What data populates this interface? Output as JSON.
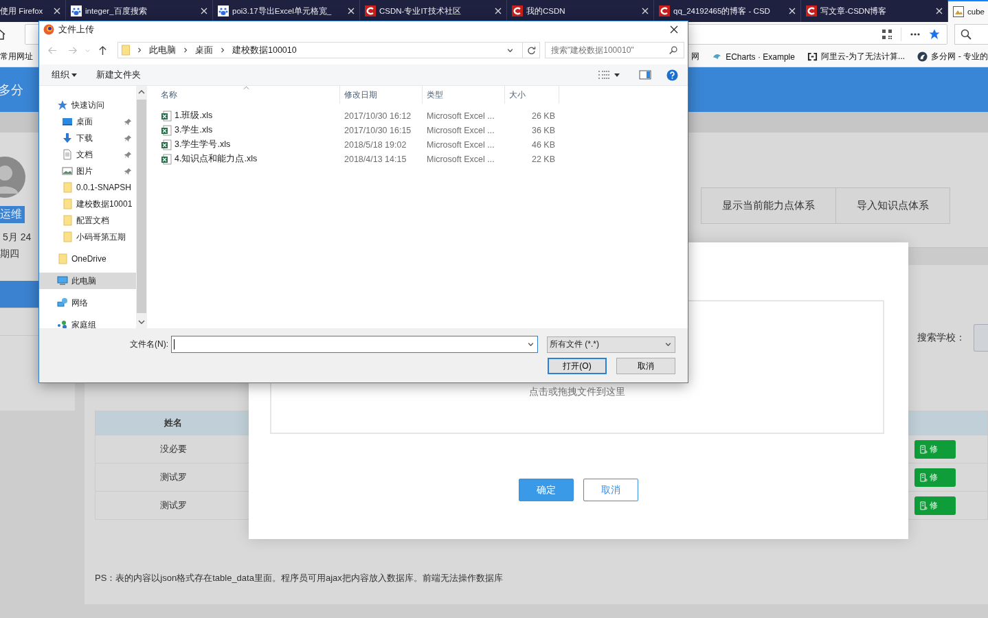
{
  "browser": {
    "tabs": [
      {
        "title": "使用 Firefox",
        "kind": "plain",
        "selected": false
      },
      {
        "title": "integer_百度搜索",
        "kind": "paw",
        "selected": false
      },
      {
        "title": "poi3.17导出Excel单元格宽_",
        "kind": "paw",
        "selected": false
      },
      {
        "title": "CSDN-专业IT技术社区",
        "kind": "csdn",
        "selected": false
      },
      {
        "title": "我的CSDN",
        "kind": "csdn",
        "selected": false
      },
      {
        "title": "qq_24192465的博客 - CSD",
        "kind": "csdn",
        "selected": false
      },
      {
        "title": "写文章-CSDN博客",
        "kind": "csdn",
        "selected": false
      },
      {
        "title": "cube",
        "kind": "image",
        "selected": true
      }
    ],
    "bookmarks": [
      {
        "label": "常用网址",
        "kind": "plain"
      },
      {
        "label": "网",
        "kind": "plain"
      },
      {
        "label": "ECharts · Example",
        "kind": "bird"
      },
      {
        "label": "阿里云-为了无法计算...",
        "kind": "bracket"
      },
      {
        "label": "多分网 - 专业的",
        "kind": "circle"
      }
    ]
  },
  "page": {
    "header_title": "多分",
    "user": {
      "name": "运维",
      "date": "5月 24",
      "weekday": "期四"
    },
    "menu": [
      {
        "selected": true
      },
      {
        "selected": false
      }
    ],
    "actions": [
      "显示当前能力点体系",
      "导入知识点体系"
    ],
    "search_label": "搜索学校：",
    "table": {
      "columns": [
        "姓名"
      ],
      "rows": [
        {
          "name": "没必要",
          "action": "修"
        },
        {
          "name": "测试罗",
          "action": "修"
        },
        {
          "name": "测试罗",
          "action": "修"
        }
      ]
    },
    "note": "PS：表的内容以json格式存在table_data里面。程序员可用ajax把内容放入数据库。前端无法操作数据库"
  },
  "upload_modal": {
    "drop_hint": "点击或拖拽文件到这里",
    "buttons": [
      {
        "label": "确定",
        "kind": "primary"
      },
      {
        "label": "取消",
        "kind": "default"
      }
    ]
  },
  "file_dialog": {
    "title": "文件上传",
    "path": [
      "此电脑",
      "桌面",
      "建校数据100010"
    ],
    "search": {
      "placeholder": "搜索\"建校数据100010\""
    },
    "toolbar": [
      {
        "label": "组织",
        "kind": "menu"
      },
      {
        "label": "新建文件夹",
        "kind": "plain"
      }
    ],
    "nav": [
      {
        "label": "快速访问",
        "kind": "star",
        "selected": false,
        "children": [
          {
            "label": "桌面",
            "kind": "desktop",
            "pinned": true,
            "selected": false
          },
          {
            "label": "下载",
            "kind": "download",
            "pinned": true,
            "selected": false
          },
          {
            "label": "文档",
            "kind": "document",
            "pinned": true,
            "selected": false
          },
          {
            "label": "图片",
            "kind": "image",
            "pinned": true,
            "selected": false
          },
          {
            "label": "0.0.1-SNAPSH",
            "kind": "folder",
            "pinned": false,
            "selected": false
          },
          {
            "label": "建校数据10001",
            "kind": "folder",
            "pinned": false,
            "selected": false
          },
          {
            "label": "配置文档",
            "kind": "folder",
            "pinned": false,
            "selected": false
          },
          {
            "label": "小码哥第五期",
            "kind": "folder",
            "pinned": false,
            "selected": false
          }
        ]
      },
      {
        "label": "OneDrive",
        "kind": "folder",
        "selected": false
      },
      {
        "label": "此电脑",
        "kind": "computer",
        "selected": true
      },
      {
        "label": "网络",
        "kind": "network",
        "selected": false
      },
      {
        "label": "家庭组",
        "kind": "group",
        "selected": false
      }
    ],
    "columns": [
      "名称",
      "修改日期",
      "类型",
      "大小"
    ],
    "files": [
      {
        "name": "1.班级.xls",
        "modified": "2017/10/30 16:12",
        "type": "Microsoft Excel ...",
        "size": "26 KB"
      },
      {
        "name": "3.学生.xls",
        "modified": "2017/10/30 16:15",
        "type": "Microsoft Excel ...",
        "size": "36 KB"
      },
      {
        "name": "3.学生学号.xls",
        "modified": "2018/5/18 19:02",
        "type": "Microsoft Excel ...",
        "size": "46 KB"
      },
      {
        "name": "4.知识点和能力点.xls",
        "modified": "2018/4/13 14:15",
        "type": "Microsoft Excel ...",
        "size": "22 KB"
      }
    ],
    "filename_label": "文件名(N):",
    "filter": "所有文件 (*.*)",
    "buttons": [
      {
        "label": "打开(O)",
        "kind": "default"
      },
      {
        "label": "取消",
        "kind": "plain"
      }
    ]
  }
}
